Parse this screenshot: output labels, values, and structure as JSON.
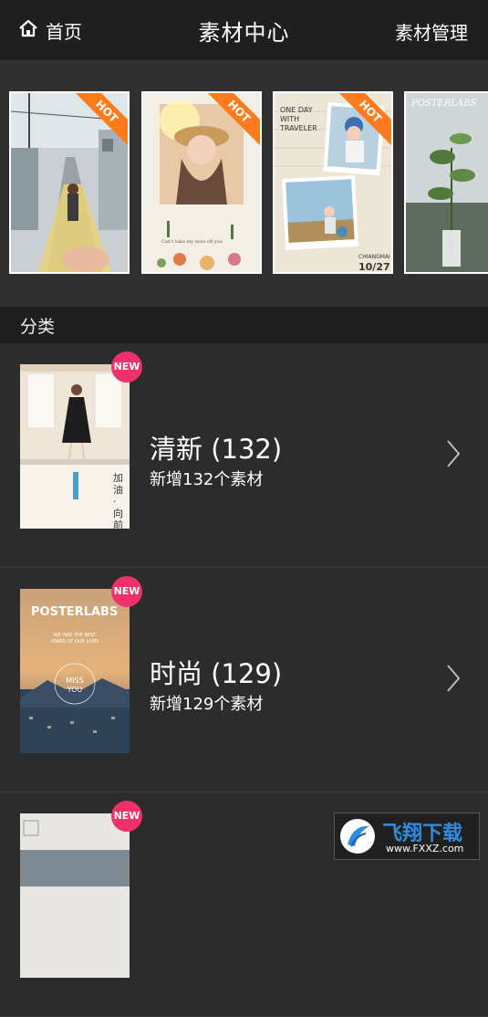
{
  "header": {
    "home_label": "首页",
    "title": "素材中心",
    "manage_label": "素材管理"
  },
  "featured": {
    "items": [
      {
        "badge": "HOT"
      },
      {
        "badge": "HOT",
        "caption": "Can't take my eyes off you"
      },
      {
        "badge": "HOT",
        "headline": "ONE DAY WITH TRAVELER",
        "place": "CHIANGMAI",
        "date": "10/27"
      },
      {
        "script": "POSTERLABS"
      }
    ]
  },
  "section": {
    "label": "分类"
  },
  "categories": [
    {
      "name": "清新 (132)",
      "subtitle": "新增132个素材",
      "badge": "NEW",
      "cover_text": "加油·向前衝"
    },
    {
      "name": "时尚 (129)",
      "subtitle": "新增129个素材",
      "badge": "NEW",
      "cover_brand": "POSTERLABS",
      "cover_text": "WE HAD THE BEST YEARS OF OUR LIVES",
      "cover_miss": "MISS YOU"
    },
    {
      "badge": "NEW"
    }
  ],
  "watermark": {
    "title": "飞翔下载",
    "url": "www.FXXZ.com"
  },
  "colors": {
    "hot": "#ff7a1a",
    "new": "#f0306b",
    "header_bg": "#1f1f1f",
    "page_bg": "#2c2c2c"
  }
}
